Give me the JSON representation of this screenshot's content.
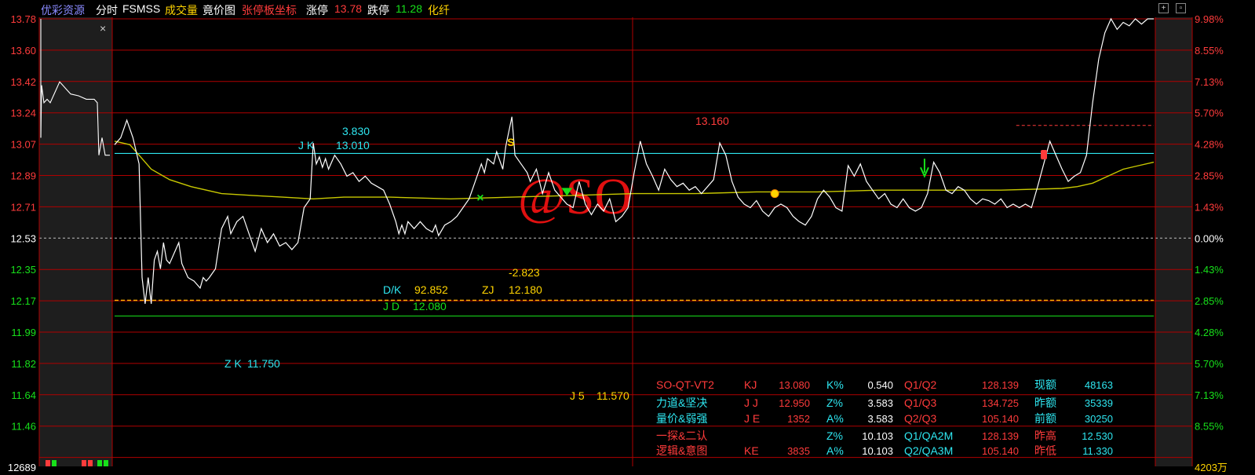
{
  "header": {
    "source": "优彩资源",
    "tab_fenshi": "分时",
    "indicator": "FSMSS",
    "volume": "成交量",
    "auction": "竟价图",
    "limit_coord": "张停板坐标",
    "limit_up_label": "涨停",
    "limit_up_value": "13.78",
    "limit_down_label": "跌停",
    "limit_down_value": "11.28",
    "industry": "化纤",
    "close_mark": "×"
  },
  "colors": {
    "up": "#ff3b3b",
    "down": "#17e01a",
    "cyan": "#2ee6f0",
    "yellow": "#ffd400",
    "price_line": "#ffffff",
    "avg_line": "#c8c800",
    "grid": "#b00000"
  },
  "chart_data": {
    "type": "line",
    "y_left_ticks": [
      "13.78",
      "13.60",
      "13.42",
      "13.24",
      "13.07",
      "12.89",
      "12.71",
      "12.53",
      "12.35",
      "12.17",
      "11.99",
      "11.82",
      "11.64",
      "11.46",
      "12689"
    ],
    "y_right_ticks": [
      "9.98%",
      "8.55%",
      "7.13%",
      "5.70%",
      "4.28%",
      "2.85%",
      "1.43%",
      "0.00%",
      "1.43%",
      "2.85%",
      "4.28%",
      "5.70%",
      "7.13%",
      "8.55%",
      "4203万"
    ],
    "ylim": [
      11.28,
      13.78
    ],
    "prev_close": 12.53,
    "series": [
      {
        "points": [
          [
            0,
            13.06
          ],
          [
            2,
            13.1
          ],
          [
            4,
            13.2
          ],
          [
            6,
            13.1
          ],
          [
            8,
            12.95
          ],
          [
            9,
            12.3
          ],
          [
            10,
            12.15
          ],
          [
            11,
            12.3
          ],
          [
            12,
            12.15
          ],
          [
            13,
            12.4
          ],
          [
            14,
            12.45
          ],
          [
            15,
            12.35
          ],
          [
            16,
            12.5
          ],
          [
            17,
            12.4
          ],
          [
            18,
            12.38
          ],
          [
            20,
            12.46
          ],
          [
            21,
            12.5
          ],
          [
            22,
            12.38
          ],
          [
            24,
            12.3
          ],
          [
            26,
            12.28
          ],
          [
            28,
            12.24
          ],
          [
            29,
            12.3
          ],
          [
            30,
            12.28
          ],
          [
            31,
            12.3
          ],
          [
            33,
            12.35
          ],
          [
            35,
            12.58
          ],
          [
            37,
            12.65
          ],
          [
            38,
            12.55
          ],
          [
            40,
            12.62
          ],
          [
            42,
            12.65
          ],
          [
            44,
            12.55
          ],
          [
            46,
            12.45
          ],
          [
            48,
            12.58
          ],
          [
            50,
            12.5
          ],
          [
            52,
            12.55
          ],
          [
            54,
            12.48
          ],
          [
            56,
            12.5
          ],
          [
            58,
            12.46
          ],
          [
            60,
            12.5
          ],
          [
            62,
            12.7
          ],
          [
            64,
            12.75
          ],
          [
            65,
            13.07
          ],
          [
            66,
            12.95
          ],
          [
            67,
            12.99
          ],
          [
            68,
            12.93
          ],
          [
            69,
            12.98
          ],
          [
            70,
            12.92
          ],
          [
            72,
            13.0
          ],
          [
            74,
            12.95
          ],
          [
            76,
            12.88
          ],
          [
            78,
            12.9
          ],
          [
            80,
            12.85
          ],
          [
            82,
            12.88
          ],
          [
            84,
            12.84
          ],
          [
            86,
            12.82
          ],
          [
            88,
            12.8
          ],
          [
            90,
            12.72
          ],
          [
            92,
            12.62
          ],
          [
            93,
            12.55
          ],
          [
            94,
            12.6
          ],
          [
            95,
            12.55
          ],
          [
            96,
            12.62
          ],
          [
            98,
            12.58
          ],
          [
            100,
            12.62
          ],
          [
            102,
            12.58
          ],
          [
            104,
            12.56
          ],
          [
            105,
            12.6
          ],
          [
            106,
            12.54
          ],
          [
            108,
            12.6
          ],
          [
            110,
            12.62
          ],
          [
            112,
            12.65
          ],
          [
            114,
            12.7
          ],
          [
            116,
            12.75
          ],
          [
            118,
            12.85
          ],
          [
            120,
            12.95
          ],
          [
            121,
            12.9
          ],
          [
            122,
            12.98
          ],
          [
            124,
            12.95
          ],
          [
            125,
            13.02
          ],
          [
            127,
            12.92
          ],
          [
            128,
            13.05
          ],
          [
            130,
            13.22
          ],
          [
            131,
            13.0
          ],
          [
            133,
            12.95
          ],
          [
            135,
            12.9
          ],
          [
            136,
            12.85
          ],
          [
            138,
            12.92
          ],
          [
            140,
            12.78
          ],
          [
            142,
            12.9
          ],
          [
            144,
            12.8
          ],
          [
            146,
            12.76
          ],
          [
            148,
            12.72
          ],
          [
            150,
            12.7
          ],
          [
            152,
            12.85
          ],
          [
            154,
            12.72
          ],
          [
            156,
            12.66
          ],
          [
            158,
            12.72
          ],
          [
            160,
            12.68
          ],
          [
            162,
            12.75
          ],
          [
            164,
            12.62
          ],
          [
            166,
            12.65
          ],
          [
            168,
            12.7
          ],
          [
            170,
            12.9
          ],
          [
            172,
            13.08
          ],
          [
            174,
            12.95
          ],
          [
            176,
            12.88
          ],
          [
            178,
            12.8
          ],
          [
            180,
            12.92
          ],
          [
            182,
            12.86
          ],
          [
            184,
            12.82
          ],
          [
            186,
            12.84
          ],
          [
            188,
            12.8
          ],
          [
            190,
            12.82
          ],
          [
            192,
            12.78
          ],
          [
            194,
            12.82
          ],
          [
            196,
            12.86
          ],
          [
            198,
            13.07
          ],
          [
            200,
            13.0
          ],
          [
            202,
            12.85
          ],
          [
            204,
            12.76
          ],
          [
            206,
            12.72
          ],
          [
            208,
            12.7
          ],
          [
            210,
            12.74
          ],
          [
            212,
            12.68
          ],
          [
            214,
            12.65
          ],
          [
            216,
            12.7
          ],
          [
            218,
            12.72
          ],
          [
            220,
            12.7
          ],
          [
            222,
            12.65
          ],
          [
            224,
            12.62
          ],
          [
            226,
            12.6
          ],
          [
            228,
            12.65
          ],
          [
            230,
            12.75
          ],
          [
            232,
            12.8
          ],
          [
            234,
            12.76
          ],
          [
            236,
            12.7
          ],
          [
            238,
            12.68
          ],
          [
            240,
            12.94
          ],
          [
            242,
            12.88
          ],
          [
            244,
            12.95
          ],
          [
            246,
            12.85
          ],
          [
            248,
            12.8
          ],
          [
            250,
            12.75
          ],
          [
            252,
            12.78
          ],
          [
            254,
            12.72
          ],
          [
            256,
            12.7
          ],
          [
            258,
            12.75
          ],
          [
            260,
            12.7
          ],
          [
            262,
            12.68
          ],
          [
            264,
            12.7
          ],
          [
            266,
            12.78
          ],
          [
            268,
            12.96
          ],
          [
            270,
            12.9
          ],
          [
            272,
            12.8
          ],
          [
            274,
            12.78
          ],
          [
            276,
            12.82
          ],
          [
            278,
            12.8
          ],
          [
            280,
            12.75
          ],
          [
            282,
            12.72
          ],
          [
            284,
            12.75
          ],
          [
            286,
            12.74
          ],
          [
            288,
            12.72
          ],
          [
            290,
            12.75
          ],
          [
            292,
            12.7
          ],
          [
            294,
            12.72
          ],
          [
            296,
            12.7
          ],
          [
            298,
            12.72
          ],
          [
            300,
            12.7
          ],
          [
            302,
            12.82
          ],
          [
            304,
            12.95
          ],
          [
            306,
            13.08
          ],
          [
            308,
            13.0
          ],
          [
            310,
            12.92
          ],
          [
            312,
            12.85
          ],
          [
            314,
            12.88
          ],
          [
            316,
            12.9
          ],
          [
            318,
            13.0
          ],
          [
            320,
            13.3
          ],
          [
            322,
            13.55
          ],
          [
            324,
            13.7
          ],
          [
            326,
            13.78
          ],
          [
            328,
            13.72
          ],
          [
            330,
            13.76
          ],
          [
            332,
            13.74
          ],
          [
            334,
            13.78
          ],
          [
            336,
            13.75
          ],
          [
            338,
            13.78
          ],
          [
            340,
            13.78
          ]
        ]
      },
      {
        "points": [
          [
            0,
            13.08
          ],
          [
            5,
            13.06
          ],
          [
            8,
            13.0
          ],
          [
            12,
            12.92
          ],
          [
            18,
            12.86
          ],
          [
            25,
            12.82
          ],
          [
            35,
            12.78
          ],
          [
            45,
            12.77
          ],
          [
            55,
            12.76
          ],
          [
            65,
            12.75
          ],
          [
            75,
            12.76
          ],
          [
            90,
            12.76
          ],
          [
            110,
            12.75
          ],
          [
            130,
            12.76
          ],
          [
            150,
            12.77
          ],
          [
            170,
            12.78
          ],
          [
            190,
            12.78
          ],
          [
            210,
            12.79
          ],
          [
            230,
            12.79
          ],
          [
            250,
            12.8
          ],
          [
            270,
            12.8
          ],
          [
            290,
            12.8
          ],
          [
            310,
            12.81
          ],
          [
            315,
            12.82
          ],
          [
            320,
            12.84
          ],
          [
            325,
            12.88
          ],
          [
            330,
            12.92
          ],
          [
            335,
            12.94
          ],
          [
            340,
            12.96
          ]
        ]
      }
    ],
    "annotations": {
      "jk_top": "3.830",
      "jk_label": "J K",
      "jk_value": "13.010",
      "peak_value": "13.160",
      "neg_value": "-2.823",
      "dk_label": "D/K",
      "dk_value": "92.852",
      "zj_label": "ZJ",
      "zj_value": "12.180",
      "jd_label": "J D",
      "jd_value": "12.080",
      "zk_label": "Z K",
      "zk_value": "11.750",
      "j5_label": "J 5",
      "j5_value": "11.570",
      "watermark": "@SO",
      "marker_s": "S"
    },
    "levels": {
      "cyan_line": 13.01,
      "dash_yellow": 12.17,
      "green_line": 12.08,
      "red_dash_short": 13.17
    }
  },
  "stats_table": {
    "rows": [
      [
        "SO-QT-VT2",
        "KJ",
        "13.080",
        "K%",
        "0.540",
        "Q1/Q2",
        "128.139",
        "现额",
        "48163"
      ],
      [
        "力道&坚决",
        "J J",
        "12.950",
        "Z%",
        "3.583",
        "Q1/Q3",
        "134.725",
        "昨额",
        "35339"
      ],
      [
        "量价&弱强",
        "J E",
        "1352",
        "A%",
        "3.583",
        "Q2/Q3",
        "105.140",
        "前额",
        "30250"
      ],
      [
        "一探&二认",
        "",
        "",
        "Z%",
        "10.103",
        "Q1/QA2M",
        "128.139",
        "昨高",
        "12.530"
      ],
      [
        "逻辑&意图",
        "KE",
        "3835",
        "A%",
        "10.103",
        "Q2/QA3M",
        "105.140",
        "昨低",
        "11.330"
      ]
    ]
  }
}
